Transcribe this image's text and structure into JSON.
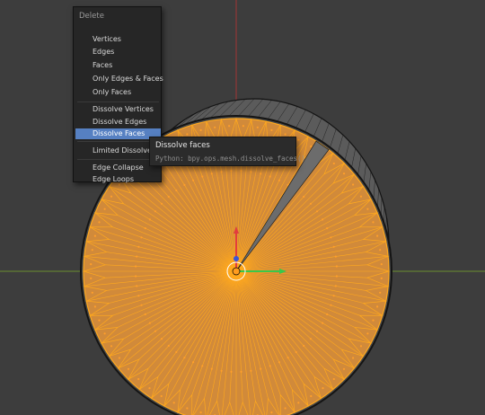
{
  "menu": {
    "title": "Delete",
    "items": [
      {
        "label": "Vertices"
      },
      {
        "label": "Edges"
      },
      {
        "label": "Faces"
      },
      {
        "label": "Only Edges & Faces"
      },
      {
        "label": "Only Faces"
      },
      {
        "label": "Dissolve Vertices"
      },
      {
        "label": "Dissolve Edges"
      },
      {
        "label": "Dissolve Faces"
      },
      {
        "label": "Limited Dissolve"
      },
      {
        "label": "Edge Collapse"
      },
      {
        "label": "Edge Loops"
      }
    ],
    "active_item": "Dissolve Faces"
  },
  "tooltip": {
    "title": "Dissolve faces",
    "python": "Python: bpy.ops.mesh.dissolve_faces()"
  },
  "viewport": {
    "background_color": "#3d3d3d",
    "face_color": "#d18a3a",
    "selected_edge_color": "#ffa91e",
    "mesh_wire_color": "#141414",
    "x_axis_color": "#a33535",
    "y_axis_color": "#6b8f2e",
    "gizmo_x_color": "#e33d3d",
    "gizmo_y_color": "#39c84a",
    "gizmo_z_color": "#3a56d6"
  }
}
